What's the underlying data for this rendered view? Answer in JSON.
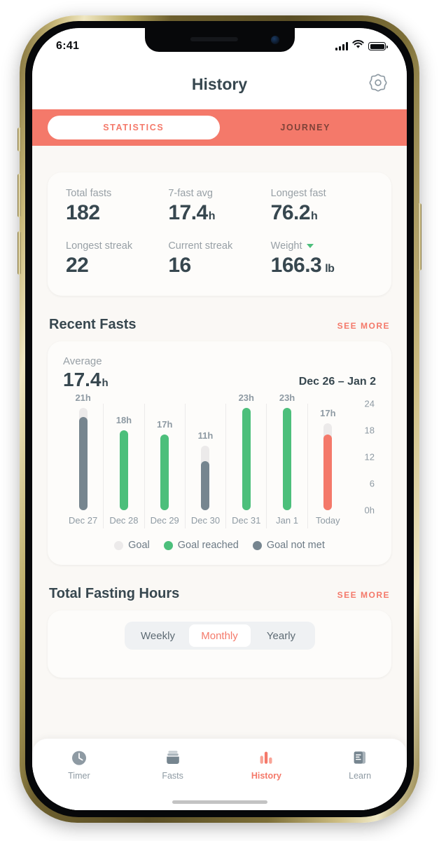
{
  "status_bar": {
    "time": "6:41",
    "signal_icon": "cellular-signal-icon",
    "wifi_icon": "wifi-icon",
    "battery_icon": "battery-full-icon"
  },
  "header": {
    "title": "History",
    "settings_icon": "gear-icon"
  },
  "segmented_tabs": {
    "items": [
      {
        "label": "STATISTICS",
        "active": true
      },
      {
        "label": "JOURNEY",
        "active": false
      }
    ]
  },
  "stats": {
    "rows": [
      [
        {
          "label": "Total fasts",
          "value": "182",
          "unit": ""
        },
        {
          "label": "7-fast avg",
          "value": "17.4",
          "unit": "h"
        },
        {
          "label": "Longest fast",
          "value": "76.2",
          "unit": "h"
        }
      ],
      [
        {
          "label": "Longest streak",
          "value": "22",
          "unit": ""
        },
        {
          "label": "Current streak",
          "value": "16",
          "unit": ""
        },
        {
          "label": "Weight",
          "value": "166.3",
          "unit": "lb",
          "caret": "chevron-down-icon"
        }
      ]
    ]
  },
  "recent_fasts": {
    "section_title": "Recent Fasts",
    "see_more": "SEE MORE",
    "average_label": "Average",
    "average_value": "17.4",
    "average_unit": "h",
    "date_range": "Dec 26 – Jan 2",
    "legend": [
      {
        "label": "Goal",
        "color": "#eceaea"
      },
      {
        "label": "Goal reached",
        "color": "#4cbf7b"
      },
      {
        "label": "Goal not met",
        "color": "#76858f"
      }
    ]
  },
  "chart_data": {
    "type": "bar",
    "title": "Recent Fasts",
    "xlabel": "",
    "ylabel": "hours",
    "ylim": [
      0,
      24
    ],
    "yticks": [
      "24",
      "18",
      "12",
      "6",
      "0h"
    ],
    "ytick_values": [
      24,
      18,
      12,
      6,
      0
    ],
    "grid": false,
    "legend_position": "bottom",
    "categories": [
      "Dec 27",
      "Dec 28",
      "Dec 29",
      "Dec 30",
      "Dec 31",
      "Jan 1",
      "Today"
    ],
    "values": [
      21,
      18,
      17,
      11,
      23,
      23,
      17
    ],
    "data_labels": [
      "21h",
      "18h",
      "17h",
      "11h",
      "23h",
      "23h",
      "17h"
    ],
    "goal_values": [
      23,
      18,
      17,
      14.5,
      23,
      23,
      19.5
    ],
    "statuses": [
      "goal-not-met",
      "goal-reached",
      "goal-reached",
      "goal-not-met",
      "goal-reached",
      "goal-reached",
      "in-progress"
    ],
    "bar_colors": [
      "#76858f",
      "#4cbf7b",
      "#4cbf7b",
      "#76858f",
      "#4cbf7b",
      "#4cbf7b",
      "#f4796a"
    ],
    "goal_color": "#eceaea"
  },
  "total_fasting_hours": {
    "section_title": "Total Fasting Hours",
    "see_more": "SEE MORE",
    "period_tabs": [
      {
        "label": "Weekly",
        "active": false
      },
      {
        "label": "Monthly",
        "active": true
      },
      {
        "label": "Yearly",
        "active": false
      }
    ]
  },
  "bottom_nav": {
    "items": [
      {
        "label": "Timer",
        "icon": "clock-icon",
        "active": false
      },
      {
        "label": "Fasts",
        "icon": "plate-icon",
        "active": false
      },
      {
        "label": "History",
        "icon": "bar-chart-icon",
        "active": true
      },
      {
        "label": "Learn",
        "icon": "document-icon",
        "active": false
      }
    ]
  },
  "theme": {
    "accent": "#f4796a",
    "green": "#4cbf7b",
    "gray": "#76858f",
    "text_dark": "#37474f",
    "text_muted": "#98a0a6",
    "background": "#faf8f5"
  }
}
